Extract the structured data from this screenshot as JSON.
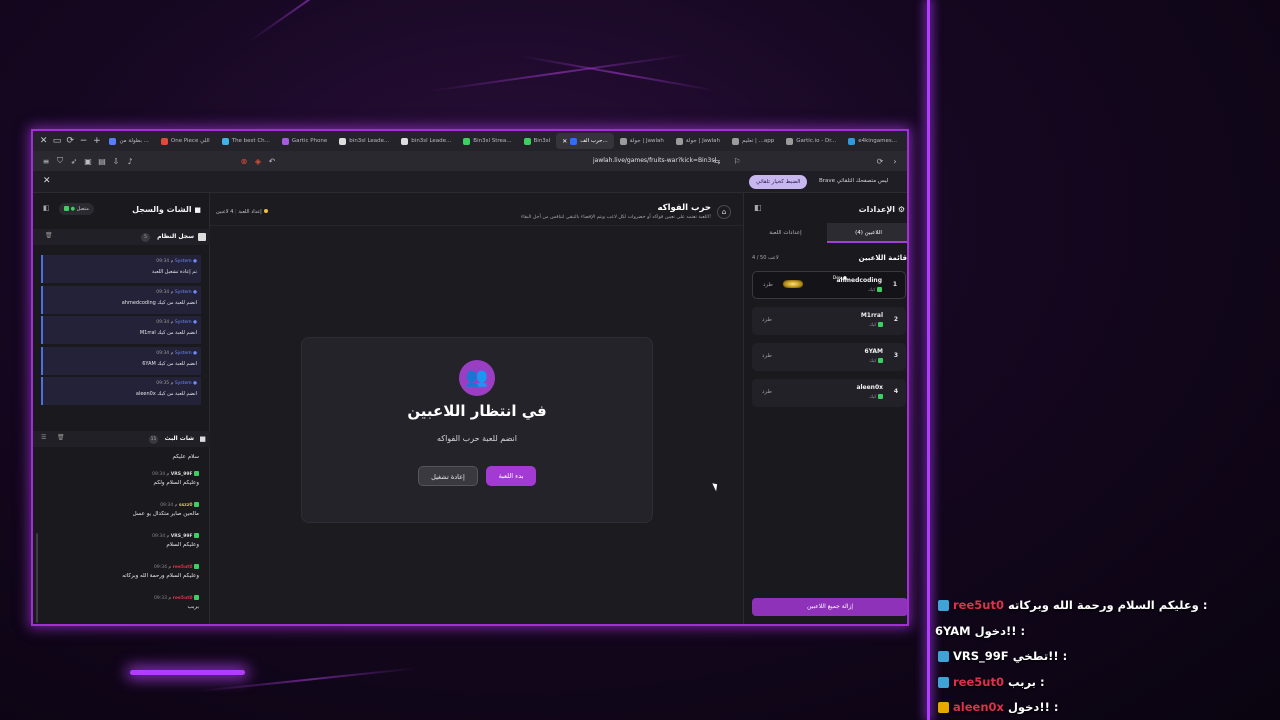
{
  "browser": {
    "tabs": [
      {
        "label": "بطولة من ...",
        "color": "#5a7cff"
      },
      {
        "label": "One Piece اللي",
        "color": "#e04a3a"
      },
      {
        "label": "The best Ch...",
        "color": "#3fb3e6"
      },
      {
        "label": "Gartic Phone",
        "color": "#a55be0"
      },
      {
        "label": "bin3sl Leade...",
        "color": "#dddddd"
      },
      {
        "label": "bin3sl Leade...",
        "color": "#dddddd"
      },
      {
        "label": "Bin3sl Strea...",
        "color": "#3ccf62"
      },
      {
        "label": "Bin3sl",
        "color": "#3ccf62"
      },
      {
        "label": "حرب الف...",
        "color": "#2f6cff",
        "active": true
      },
      {
        "label": "جولة | Jawlah",
        "color": "#9b9b9b"
      },
      {
        "label": "جولة | Jawlah",
        "color": "#9b9b9b"
      },
      {
        "label": "تعليم | ...app",
        "color": "#9b9b9b"
      },
      {
        "label": "Gartic.io - Dr...",
        "color": "#9b9b9b"
      },
      {
        "label": "e4kingames...",
        "color": "#2e9be0"
      }
    ],
    "url": "jawlah.live/games/fruits-war?kick=Bin3sl",
    "notification": {
      "message": "Brave ليس متصفحك التلقائي",
      "button": "الضبط كخيار تلقائي"
    }
  },
  "chat_panel": {
    "title": "الشات والسجل",
    "status": "متصل",
    "system_log": {
      "title": "سجل النظام",
      "count": "5",
      "messages": [
        {
          "sender": "System",
          "time": "09:34 م",
          "text": "تم إعادة تشغيل اللعبة"
        },
        {
          "sender": "System",
          "time": "09:34 م",
          "text": "ahmedcoding انضم للعبة من كيك"
        },
        {
          "sender": "System",
          "time": "09:34 م",
          "text": "M1rral انضم للعبة من كيك"
        },
        {
          "sender": "System",
          "time": "09:34 م",
          "text": "6YAM انضم للعبة من كيك"
        },
        {
          "sender": "System",
          "time": "09:35 م",
          "text": "aleen0x انضم للعبة من كيك"
        }
      ]
    },
    "live_chat": {
      "title": "شات البث",
      "count": "11",
      "first_line": "سلام عليكم",
      "messages": [
        {
          "user": "VRS_99F",
          "time": "09:34 م",
          "text": "وعليكم السلام ولكم",
          "color": "#dddddd"
        },
        {
          "user": "sszz0",
          "time": "09:34 م",
          "text": "مالحين صاير متكدال يو عسل",
          "color": "#d8c65a"
        },
        {
          "user": "VRS_99F",
          "time": "09:34 م",
          "text": "وعليكم السلام",
          "color": "#dddddd"
        },
        {
          "user": "ree5ut0",
          "time": "09:34 م",
          "text": "وعليكم السلام ورحمة الله وبركاته",
          "color": "#e0304e"
        },
        {
          "user": "ree5ut0",
          "time": "09:33 م",
          "text": "بربب",
          "color": "#e0304e"
        }
      ]
    }
  },
  "game": {
    "title": "حرب الفواكه",
    "description": "اللعبة تعتمد على تعيين فواكه أو خضروات لكل لاعب ويتم الإقصاء بالتنقي لتنافس من أجل البقاء!",
    "player_count_label": "4 لاعبين",
    "settings_label": "إعداد اللعبة",
    "waiting": {
      "heading": "في انتظار اللاعبين",
      "subtitle": "انضم للعبة حرب الفواكه",
      "start_button": "بدء اللعبة",
      "restart_button": "إعادة تشغيل"
    }
  },
  "settings_panel": {
    "title": "الإعدادات",
    "tabs": [
      {
        "label": "اللاعبين (4)",
        "active": true
      },
      {
        "label": "إعدادات اللعبة",
        "active": false
      }
    ],
    "list_title": "قائمة اللاعبين",
    "count": "4 / 50 لاعب",
    "kick_label": "طرد",
    "players": [
      {
        "rank": "1",
        "name": "ahmedcoding",
        "sub": "كيك",
        "badge": "Dev ●"
      },
      {
        "rank": "2",
        "name": "M1rral",
        "sub": "كيك",
        "badge": ""
      },
      {
        "rank": "3",
        "name": "6YAM",
        "sub": "كيك",
        "badge": ""
      },
      {
        "rank": "4",
        "name": "aleen0x",
        "sub": "كيك",
        "badge": ""
      }
    ],
    "remove_all_button": "إزالة جميع اللاعبين"
  },
  "stream_chat": [
    {
      "user": "ree5ut0",
      "text": "وعليكم السلام ورحمة الله وبركاته :",
      "user_color": "#e0304e",
      "badge_color": "#3fa3d6"
    },
    {
      "user": "6YAM",
      "text": "دخول!! :",
      "user_color": "#ffffff",
      "badge_color": ""
    },
    {
      "user": "VRS_99F",
      "text": "تطخي!! :",
      "user_color": "#ffffff",
      "badge_color": "#3fa3d6"
    },
    {
      "user": "ree5ut0",
      "text": "بربب :",
      "user_color": "#e0304e",
      "badge_color": "#3fa3d6"
    },
    {
      "user": "aleen0x",
      "text": "دخول!! :",
      "user_color": "#e0304e",
      "badge_color": "#e6a800"
    }
  ]
}
